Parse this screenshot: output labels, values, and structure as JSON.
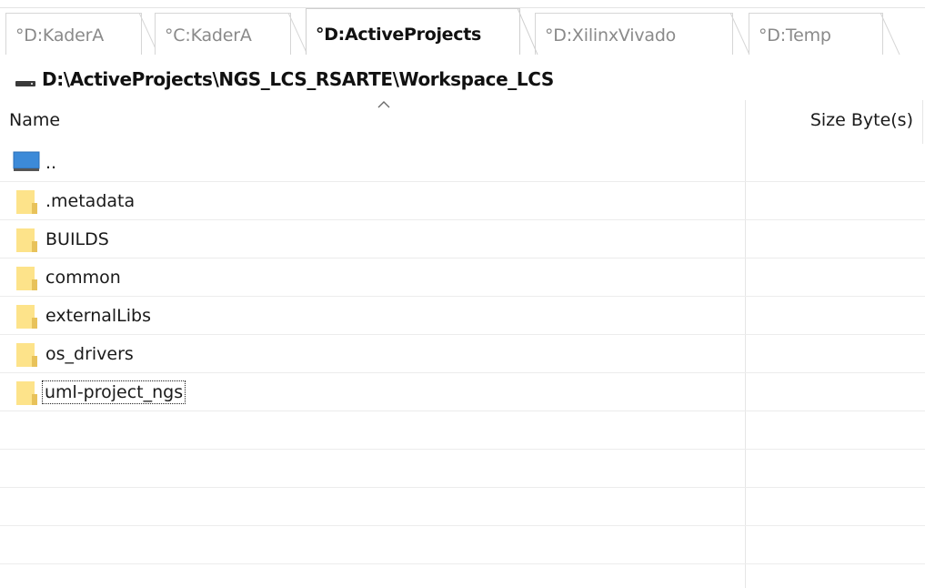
{
  "tabs": [
    {
      "label": "°D:KaderA",
      "active": false
    },
    {
      "label": "°C:KaderA",
      "active": false
    },
    {
      "label": "°D:ActiveProjects",
      "active": true
    },
    {
      "label": "°D:XilinxVivado",
      "active": false
    },
    {
      "label": "°D:Temp",
      "active": false
    }
  ],
  "path": {
    "icon": "drive-icon",
    "text": "D:\\ActiveProjects\\NGS_LCS_RSARTE\\Workspace_LCS"
  },
  "columns": {
    "name": "Name",
    "size": "Size Byte(s)",
    "sort_icon": "chevron-up-icon"
  },
  "rows": [
    {
      "name": "..",
      "icon": "parent-directory-icon",
      "size": ""
    },
    {
      "name": ".metadata",
      "icon": "folder-icon",
      "size": ""
    },
    {
      "name": "BUILDS",
      "icon": "folder-icon",
      "size": ""
    },
    {
      "name": "common",
      "icon": "folder-icon",
      "size": ""
    },
    {
      "name": "externalLibs",
      "icon": "folder-icon",
      "size": ""
    },
    {
      "name": "os_drivers",
      "icon": "folder-icon",
      "size": ""
    },
    {
      "name": "uml-project_ngs",
      "icon": "folder-icon",
      "size": "",
      "focused": true
    }
  ],
  "colors": {
    "folder_fill": "#fde38a",
    "folder_edge": "#e8c25a",
    "up_icon_fill": "#3c8ad8",
    "active_tab_text": "#111111",
    "inactive_tab_text": "#8a8a8a"
  }
}
